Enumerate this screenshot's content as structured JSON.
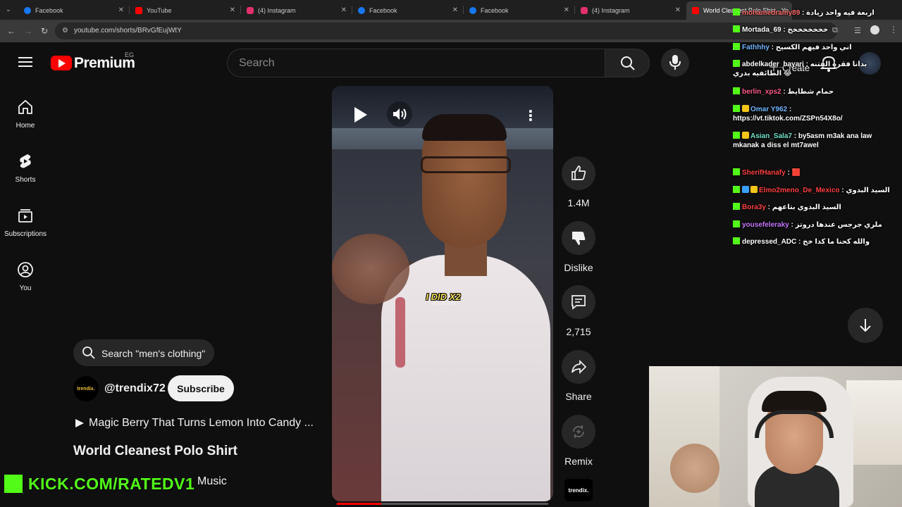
{
  "browser": {
    "tabs": [
      {
        "label": "Facebook",
        "icon": "facebook-icon",
        "color": "#1877f2"
      },
      {
        "label": "YouTube",
        "icon": "youtube-icon",
        "color": "#ff0000"
      },
      {
        "label": "(4) Instagram",
        "icon": "instagram-icon",
        "color": "#e1306c"
      },
      {
        "label": "Facebook",
        "icon": "facebook-icon",
        "color": "#1877f2"
      },
      {
        "label": "Facebook",
        "icon": "facebook-icon",
        "color": "#1877f2"
      },
      {
        "label": "(4) Instagram",
        "icon": "instagram-icon",
        "color": "#e1306c"
      },
      {
        "label": "World Cleanest Polo Shirt - Yo",
        "icon": "youtube-icon",
        "color": "#ff0000"
      }
    ],
    "url": "youtube.com/shorts/BRvGfEujWtY"
  },
  "header": {
    "logo": "Premium",
    "country": "EG",
    "search_placeholder": "Search",
    "create_label": "Create"
  },
  "sidebar": {
    "items": [
      {
        "label": "Home",
        "icon": "home-icon"
      },
      {
        "label": "Shorts",
        "icon": "shorts-icon"
      },
      {
        "label": "Subscriptions",
        "icon": "subscriptions-icon"
      },
      {
        "label": "You",
        "icon": "user-circle-icon"
      }
    ]
  },
  "video": {
    "caption": "I DID X2",
    "caption_brand": "TRENDIX",
    "progress": 0.21
  },
  "actions": {
    "like_count": "1.4M",
    "dislike_label": "Dislike",
    "comments_count": "2,715",
    "share_label": "Share",
    "remix_label": "Remix",
    "avatar_text": "trendix."
  },
  "info": {
    "search_suggestion": "Search \"men's clothing\"",
    "channel_avatar_text": "trendix.",
    "channel": "@trendix72",
    "subscribe_label": "Subscribe",
    "related_title": "Magic Berry That Turns Lemon Into Candy ...",
    "title": "World Cleanest Polo Shirt",
    "music_label": "Music"
  },
  "overlay": {
    "kick_watermark": "KICK.COM/RATEDV1"
  },
  "chat": {
    "messages": [
      {
        "user": "mohamedramy89",
        "user_color": "#ff6b6b",
        "text": "اربعة فيه واحد زيادة",
        "badges": []
      },
      {
        "user": "Mortada_69",
        "user_color": "#ffffff",
        "text": "خخخخخخخخ",
        "badges": []
      },
      {
        "user": "Fathhhy",
        "user_color": "#6fb6ff",
        "text": "اني واحد فيهم الكسيح",
        "badges": []
      },
      {
        "user": "abdelkader_bayari",
        "user_color": "#ffffff",
        "text": "بدانا فقرة الفتنه الطائفيه بدري 😂",
        "badges": []
      },
      {
        "user": "berlin_xps2",
        "user_color": "#ff5c8a",
        "text": "حمام شطايط",
        "badges": []
      },
      {
        "user": "Omar Y962",
        "user_color": "#6fb6ff",
        "text": "https://vt.tiktok.com/ZSPn54X8o/",
        "badges": [
          "#f5c518"
        ]
      },
      {
        "user": "Asian_Sala7",
        "user_color": "#6fe3c8",
        "text": "by5asm m3ak ana law mkanak a diss el mt7awel",
        "badges": [
          "#f5c518"
        ]
      },
      {
        "user": "SherifHanafy",
        "user_color": "#ff4040",
        "text": "🟥",
        "badges": []
      },
      {
        "user": "Elmo2meno_De_Mexico",
        "user_color": "#ff4040",
        "text": "السيد البدوي",
        "badges": [
          "#3aa0ff",
          "#f5c518"
        ]
      },
      {
        "user": "Bora3y",
        "user_color": "#ff4040",
        "text": "السيد البدوي بتاعهم",
        "badges": []
      },
      {
        "user": "yousefeleraky",
        "user_color": "#c678ff",
        "text": "ملري جرجس عندها دروتز",
        "badges": []
      },
      {
        "user": "depressed_ADC",
        "user_color": "#ffffff",
        "text": "والله كحنا ما كدا خخ",
        "badges": []
      }
    ]
  },
  "colors": {
    "youtube_red": "#ff0000",
    "kick_green": "#53fc18",
    "bg": "#0f0f0f"
  }
}
